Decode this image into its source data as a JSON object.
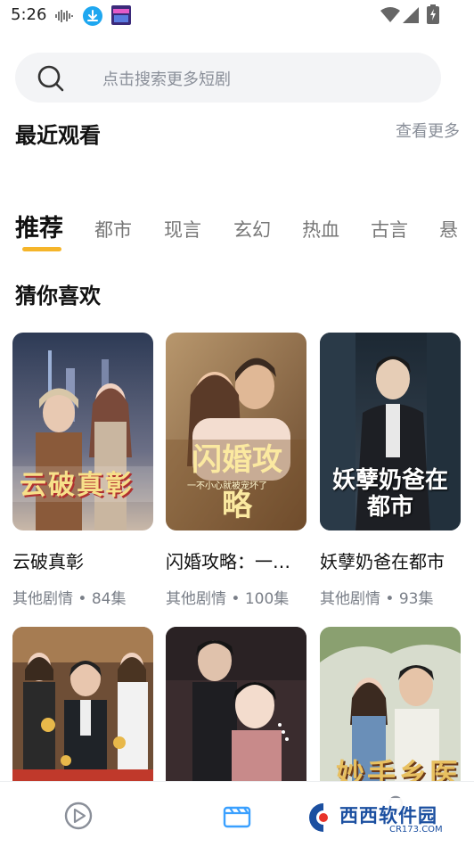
{
  "status_bar": {
    "time": "5:26"
  },
  "search": {
    "placeholder": "点击搜索更多短剧"
  },
  "recent": {
    "title": "最近观看",
    "more_label": "查看更多"
  },
  "tabs": [
    "推荐",
    "都市",
    "现言",
    "玄幻",
    "热血",
    "古言",
    "悬"
  ],
  "active_tab": "推荐",
  "section_title": "猜你喜欢",
  "cards": [
    {
      "title": "云破真彰",
      "genre": "其他剧情",
      "episodes": "84集",
      "poster_text": "云破真彰"
    },
    {
      "title": "闪婚攻略：一…",
      "genre": "其他剧情",
      "episodes": "100集",
      "poster_text": "闪婚攻略",
      "poster_subtext": "一不小心就被宠坏了"
    },
    {
      "title": "妖孽奶爸在都市",
      "genre": "其他剧情",
      "episodes": "93集",
      "poster_text": "妖孽奶爸在都市"
    },
    {
      "title": "",
      "genre": "",
      "episodes": ""
    },
    {
      "title": "",
      "genre": "",
      "episodes": ""
    },
    {
      "title": "",
      "genre": "",
      "episodes": "",
      "poster_text": "妙手乡医"
    }
  ],
  "meta_separator": " • ",
  "watermark": {
    "text": "西西软件园",
    "subtext": "CR173.COM"
  },
  "colors": {
    "accent": "#f5b52a",
    "nav_active": "#3aa0ff",
    "download_badge": "#1ea7f0"
  },
  "icons": [
    "wifi-icon",
    "signal-icon",
    "battery-icon",
    "download-icon",
    "search-icon",
    "play-circle-icon",
    "clapperboard-icon"
  ]
}
